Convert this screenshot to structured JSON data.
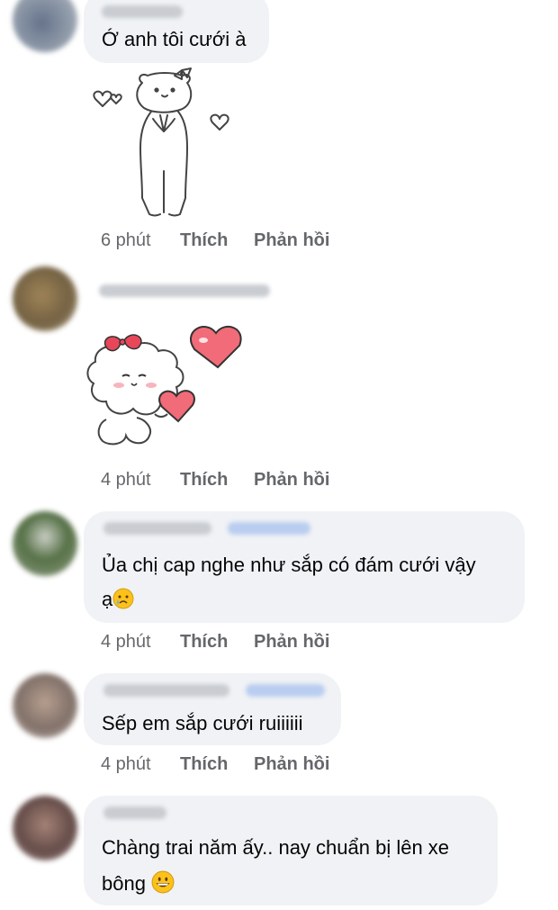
{
  "comments": [
    {
      "text": "Ớ anh tôi cưới à",
      "time": "6 phút",
      "like": "Thích",
      "reply": "Phản hồi",
      "sticker": "bear-sticker"
    },
    {
      "text": "",
      "time": "4 phút",
      "like": "Thích",
      "reply": "Phản hồi",
      "sticker": "sheep-heart-sticker"
    },
    {
      "text_line1": "Ủa chị cap nghe như sắp có đám cưới vậy",
      "text_line2": "ạ",
      "emoji": "crying-face-emoji",
      "time": "4 phút",
      "like": "Thích",
      "reply": "Phản hồi"
    },
    {
      "text": "Sếp em sắp cưới ruiiiiii",
      "time": "4 phút",
      "like": "Thích",
      "reply": "Phản hồi"
    },
    {
      "text_line1": "Chàng trai năm ấy.. nay chuẩn bị lên xe",
      "text_line2": "bông",
      "emoji": "grinning-face-emoji"
    }
  ],
  "colors": {
    "bubble": "#f0f2f5",
    "action_text": "#65676b",
    "link_blue": "#b9cdf0"
  }
}
